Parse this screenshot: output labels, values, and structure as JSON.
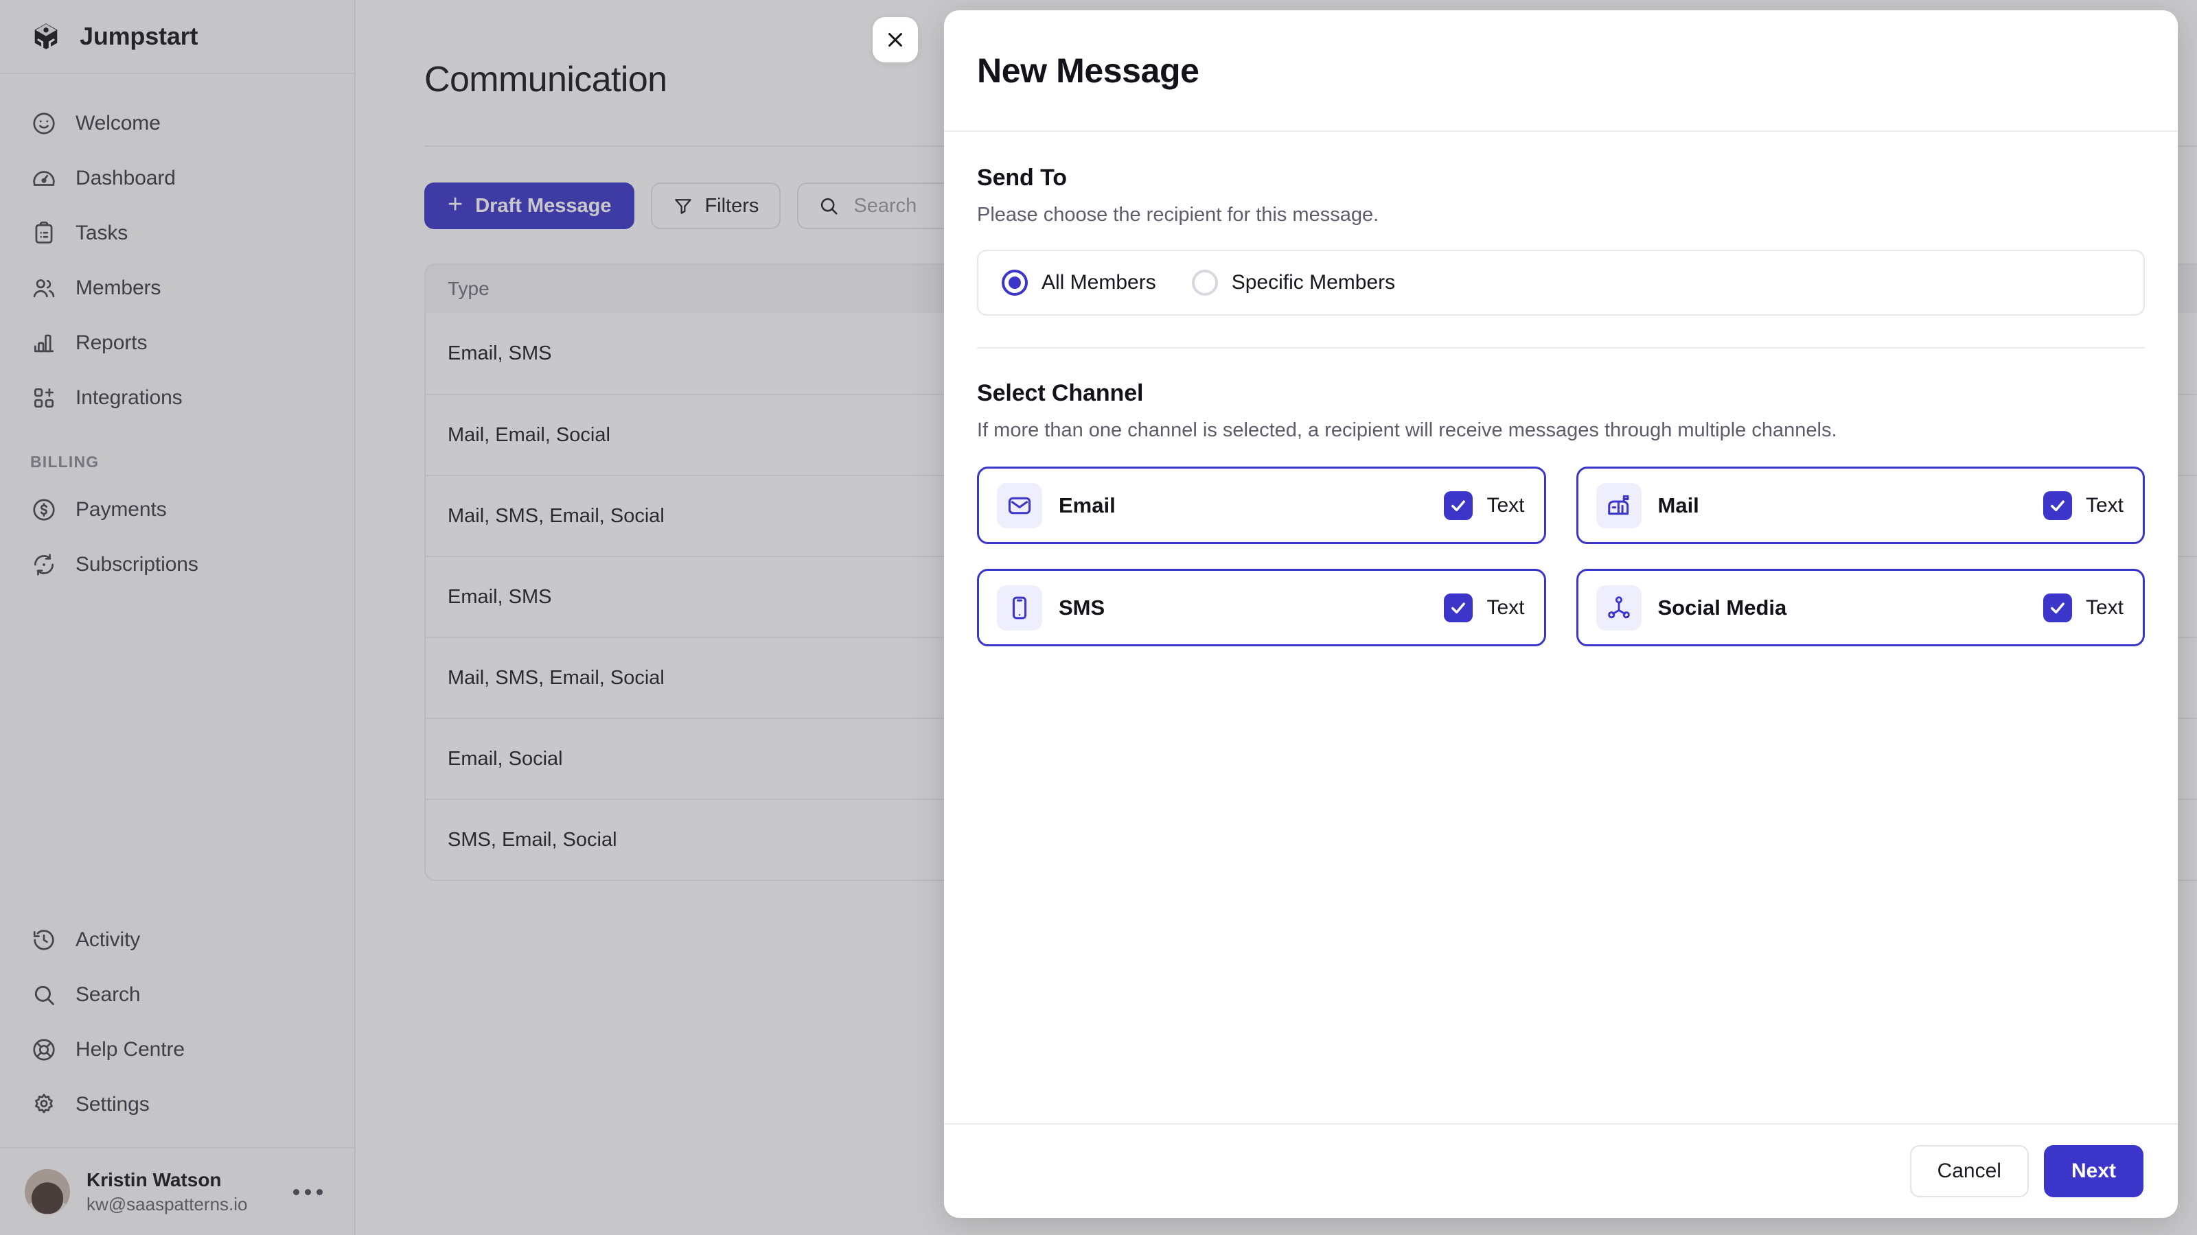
{
  "theme": {
    "accent": "#3B35C9",
    "accent_soft": "#EEEEFC",
    "text_primary": "#121219",
    "text_muted": "#5D5D6A",
    "border": "#E6E6EC"
  },
  "sidebar": {
    "brand": {
      "name": "Jumpstart",
      "icon": "cube-icon"
    },
    "top_items": [
      {
        "label": "Welcome",
        "icon": "smiley-icon"
      },
      {
        "label": "Dashboard",
        "icon": "gauge-icon"
      },
      {
        "label": "Tasks",
        "icon": "clipboard-icon"
      },
      {
        "label": "Members",
        "icon": "users-icon"
      },
      {
        "label": "Reports",
        "icon": "bar-chart-icon"
      },
      {
        "label": "Integrations",
        "icon": "grid-plus-icon"
      }
    ],
    "section_label": "BILLING",
    "billing_items": [
      {
        "label": "Payments",
        "icon": "dollar-circle-icon"
      },
      {
        "label": "Subscriptions",
        "icon": "refresh-icon"
      }
    ],
    "bottom_items": [
      {
        "label": "Activity",
        "icon": "clock-history-icon"
      },
      {
        "label": "Search",
        "icon": "search-icon"
      },
      {
        "label": "Help Centre",
        "icon": "lifebuoy-icon"
      },
      {
        "label": "Settings",
        "icon": "gear-icon"
      }
    ],
    "profile": {
      "name": "Kristin Watson",
      "email": "kw@saaspatterns.io",
      "more_icon": "ellipsis-icon"
    }
  },
  "main": {
    "page_title": "Communication",
    "toolbar": {
      "draft_label": "Draft Message",
      "draft_icon": "plus-icon",
      "filters_label": "Filters",
      "filters_icon": "funnel-icon",
      "search_placeholder": "Search",
      "search_value": "",
      "search_icon": "search-icon"
    },
    "table": {
      "columns": [
        "Type"
      ],
      "rows": [
        {
          "type": "Email, SMS"
        },
        {
          "type": "Mail, Email, Social"
        },
        {
          "type": "Mail, SMS, Email, Social"
        },
        {
          "type": "Email, SMS"
        },
        {
          "type": "Mail, SMS, Email, Social"
        },
        {
          "type": "Email, Social"
        },
        {
          "type": "SMS, Email, Social"
        }
      ]
    }
  },
  "modal": {
    "title": "New Message",
    "close_icon": "close-icon",
    "send_to": {
      "title": "Send To",
      "description": "Please choose the recipient for this message.",
      "options": [
        {
          "label": "All Members",
          "selected": true
        },
        {
          "label": "Specific Members",
          "selected": false
        }
      ]
    },
    "select_channel": {
      "title": "Select Channel",
      "description": "If more than one channel is selected, a recipient will receive messages through multiple channels.",
      "channels": [
        {
          "name": "Email",
          "icon": "envelope-icon",
          "checkbox_label": "Text",
          "checked": true
        },
        {
          "name": "Mail",
          "icon": "mailbox-icon",
          "checkbox_label": "Text",
          "checked": true
        },
        {
          "name": "SMS",
          "icon": "phone-icon",
          "checkbox_label": "Text",
          "checked": true
        },
        {
          "name": "Social Media",
          "icon": "share-network-icon",
          "checkbox_label": "Text",
          "checked": true
        }
      ]
    },
    "footer": {
      "cancel_label": "Cancel",
      "next_label": "Next"
    }
  }
}
